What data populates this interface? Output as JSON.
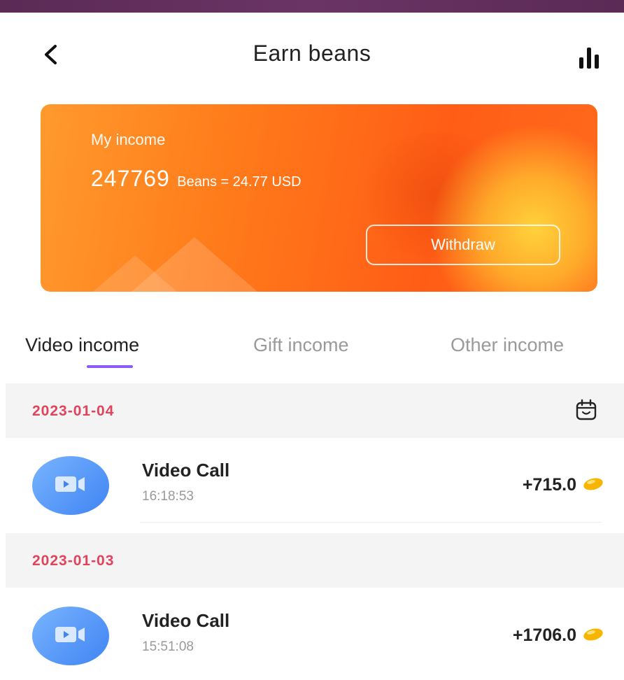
{
  "header": {
    "title": "Earn beans"
  },
  "income_card": {
    "label": "My income",
    "amount": "247769",
    "conversion": "Beans = 24.77 USD",
    "withdraw_label": "Withdraw"
  },
  "tabs": [
    {
      "label": "Video income",
      "active": true
    },
    {
      "label": "Gift income",
      "active": false
    },
    {
      "label": "Other income",
      "active": false
    }
  ],
  "groups": [
    {
      "date": "2023-01-04",
      "items": [
        {
          "name": "Video Call",
          "time": "16:18:53",
          "amount": "+715.0"
        }
      ]
    },
    {
      "date": "2023-01-03",
      "items": [
        {
          "name": "Video Call",
          "time": "15:51:08",
          "amount": "+1706.0"
        }
      ]
    }
  ],
  "icons": {
    "back": "chevron-left-icon",
    "stats": "bar-chart-icon",
    "calendar": "calendar-icon",
    "video": "video-camera-icon",
    "bean": "bean-coin-icon"
  },
  "colors": {
    "card_orange": "#ff7a1a",
    "date_red": "#e0435c",
    "tab_indicator": "#8b5cf6",
    "video_blue": "#4a8df6",
    "bean_gold": "#f7b500"
  }
}
